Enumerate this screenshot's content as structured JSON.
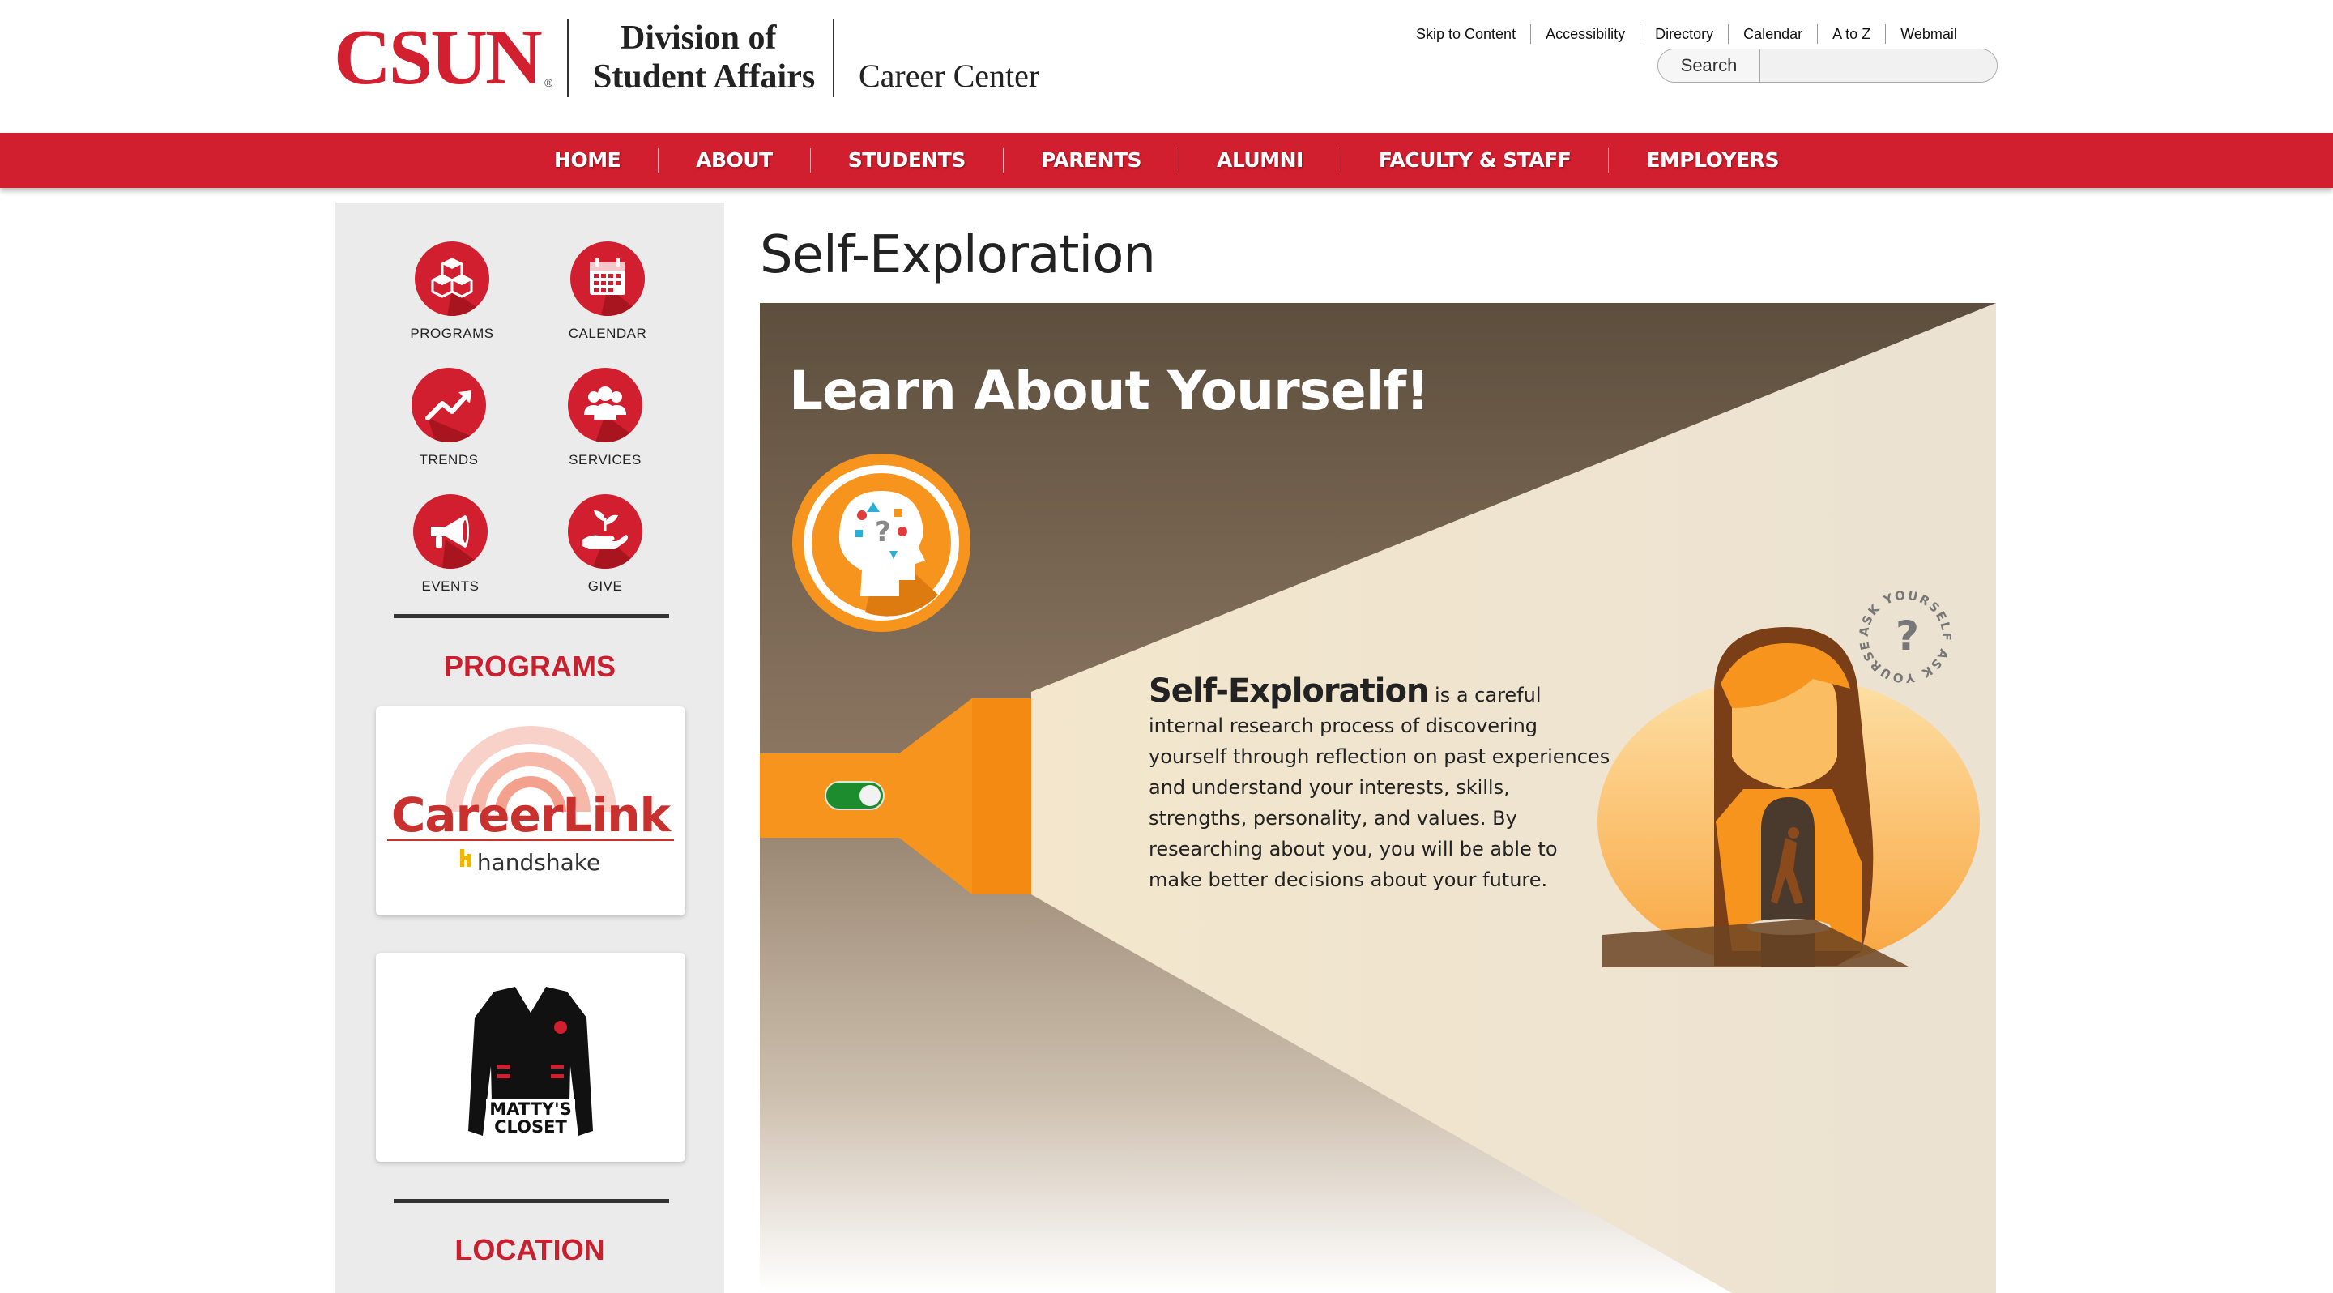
{
  "header": {
    "logo": "CSUN",
    "logo_mark": "®",
    "division_line1": "Division of",
    "division_line2": "Student Affairs",
    "department": "Career Center"
  },
  "utility_links": [
    "Skip to Content",
    "Accessibility",
    "Directory",
    "Calendar",
    "A to Z",
    "Webmail"
  ],
  "search": {
    "button_label": "Search",
    "value": ""
  },
  "nav": [
    "HOME",
    "ABOUT",
    "STUDENTS",
    "PARENTS",
    "ALUMNI",
    "FACULTY & STAFF",
    "EMPLOYERS"
  ],
  "sidebar": {
    "icons": [
      {
        "label": "PROGRAMS",
        "icon": "cubes-icon"
      },
      {
        "label": "CALENDAR",
        "icon": "calendar-icon"
      },
      {
        "label": "TRENDS",
        "icon": "trend-arrow-icon"
      },
      {
        "label": "SERVICES",
        "icon": "people-group-icon"
      },
      {
        "label": "EVENTS",
        "icon": "megaphone-icon"
      },
      {
        "label": "GIVE",
        "icon": "hand-plant-icon"
      }
    ],
    "programs_heading": "PROGRAMS",
    "careerlink": {
      "brand": "CareerLink",
      "partner": "handshake"
    },
    "mattys_closet": {
      "line1": "MATTY'S",
      "line2": "CLOSET"
    },
    "location_heading": "LOCATION"
  },
  "main": {
    "title": "Self-Exploration",
    "hero": {
      "heading": "Learn About Yourself!",
      "term": "Self-Exploration",
      "description": " is a careful internal research process of discovering yourself through reflection on past experiences and understand your interests, skills, strengths, personality, and values. By researching about you, you will be able to make better decisions about your future.",
      "badge_text": "ASK YOURSELF ASK YOURSELF",
      "colors": {
        "beam": "#f2e6cf",
        "dark": "#5e4f3e",
        "flashlight": "#f7941d",
        "toggle": "#1d8c2e"
      }
    }
  }
}
